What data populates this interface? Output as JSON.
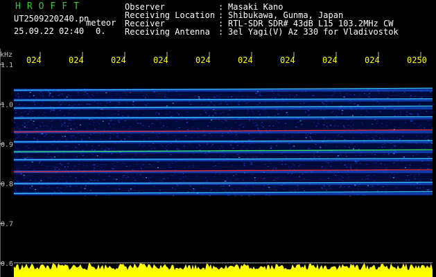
{
  "header": {
    "brand": "HROFFT",
    "filename": "UT2509220240.pn",
    "datetime": "25.09.22 02:40",
    "unit_label": "meteor",
    "value_label": "0.",
    "info": [
      {
        "key": "Observer",
        "value": "Masaki Kano"
      },
      {
        "key": "Receiving Location",
        "value": "Shibukawa, Gunma, Japan"
      },
      {
        "key": "Receiver",
        "value": "RTL-SDR SDR# 43dB L15 103.2MHz CW"
      },
      {
        "key": "Receiving Antenna",
        "value": "3el Yagi(V) Az 330 for Vladivostok"
      }
    ]
  },
  "colors": {
    "brand": "#33cc33",
    "text": "#ffffff",
    "axis": "#c0c0c0",
    "time_label": "#ffff00",
    "background": "#000000",
    "spectrum": "#ffff00"
  },
  "chart_data": {
    "type": "heatmap",
    "ylabel": "kHz",
    "y_ticks": [
      "1.1",
      "1.0",
      "0.9",
      "0.8",
      "0.7",
      "0.6"
    ],
    "x_ticks": [
      "024",
      "024",
      "024",
      "024",
      "024",
      "024",
      "024",
      "024",
      "024",
      "0250"
    ],
    "ylim": [
      0.6,
      1.14
    ],
    "signal_band": [
      0.77,
      1.04
    ],
    "lines": [
      {
        "freq": 1.035,
        "strength": 0.55
      },
      {
        "freq": 1.01,
        "strength": 0.5
      },
      {
        "freq": 0.99,
        "strength": 0.45
      },
      {
        "freq": 0.965,
        "strength": 0.6
      },
      {
        "freq": 0.93,
        "strength": 1.0
      },
      {
        "freq": 0.905,
        "strength": 0.55
      },
      {
        "freq": 0.88,
        "strength": 0.75
      },
      {
        "freq": 0.86,
        "strength": 0.5
      },
      {
        "freq": 0.83,
        "strength": 0.9
      },
      {
        "freq": 0.8,
        "strength": 0.45
      },
      {
        "freq": 0.775,
        "strength": 0.4
      }
    ]
  }
}
